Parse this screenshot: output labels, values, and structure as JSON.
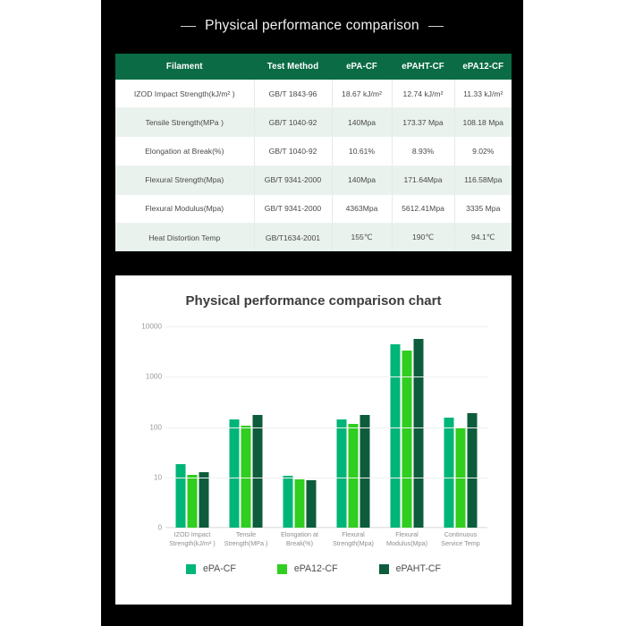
{
  "page": {
    "title": "Physical performance comparison",
    "background_color": "#000000",
    "margin_color": "#ffffff"
  },
  "table": {
    "header_color": "#0a6b45",
    "alt_row_color": "#e9f2ec",
    "columns": [
      "Filament",
      "Test Method",
      "ePA-CF",
      "ePAHT-CF",
      "ePA12-CF"
    ],
    "rows": [
      {
        "filament": "IZOD Impact Strength(kJ/m² )",
        "method": "GB/T 1843-96",
        "epa": "18.67 kJ/m²",
        "epaht": "12.74 kJ/m²",
        "epa12": "11.33 kJ/m²"
      },
      {
        "filament": "Tensile Strength(MPa )",
        "method": "GB/T 1040-92",
        "epa": "140Mpa",
        "epaht": "173.37 Mpa",
        "epa12": "108.18 Mpa"
      },
      {
        "filament": "Elongation at Break(%)",
        "method": "GB/T 1040-92",
        "epa": "10.61%",
        "epaht": "8.93%",
        "epa12": "9.02%"
      },
      {
        "filament": "Flexural Strength(Mpa)",
        "method": "GB/T 9341-2000",
        "epa": "140Mpa",
        "epaht": "171.64Mpa",
        "epa12": "116.58Mpa"
      },
      {
        "filament": "Flexural Modulus(Mpa)",
        "method": "GB/T 9341-2000",
        "epa": "4363Mpa",
        "epaht": "5612.41Mpa",
        "epa12": "3335 Mpa"
      },
      {
        "filament": "Heat Distortion Temp",
        "method": "GB/T1634-2001",
        "epa": "155℃",
        "epaht": "190℃",
        "epa12": "94.1℃"
      }
    ]
  },
  "chart_data": {
    "type": "bar",
    "title": "Physical performance comparison chart",
    "xlabel": "",
    "ylabel": "",
    "scale": "log-like",
    "yticks": [
      0,
      10,
      100,
      1000,
      10000
    ],
    "ytick_labels": [
      "0",
      "10",
      "100",
      "1000",
      "10000"
    ],
    "grid": true,
    "legend_position": "bottom",
    "categories": [
      "IZOD Impact Strength(kJ/m² )",
      "Tensile Strength(MPa )",
      "Elongation at Break(%)",
      "Flexural Strength(Mpa)",
      "Flexural Modulus(Mpa)",
      "Continuous Service Temp"
    ],
    "category_lines": [
      [
        "IZOD Impact",
        "Strength(kJ/m² )"
      ],
      [
        "Tensile",
        "Strength(MPa )"
      ],
      [
        "Elongation at",
        "Break(%)"
      ],
      [
        "Flexural",
        "Strength(Mpa)"
      ],
      [
        "Flexural",
        "Modulus(Mpa)"
      ],
      [
        "Continuous",
        "Service Temp"
      ]
    ],
    "series": [
      {
        "name": "ePA-CF",
        "color": "#00b578",
        "values": [
          18.67,
          140,
          10.61,
          140,
          4363,
          155
        ]
      },
      {
        "name": "ePA12-CF",
        "color": "#2fce1f",
        "values": [
          11.33,
          108.18,
          9.02,
          116.58,
          3335,
          94.1
        ]
      },
      {
        "name": "ePAHT-CF",
        "color": "#0d5c3c",
        "values": [
          12.74,
          173.37,
          8.93,
          171.64,
          5612.41,
          190
        ]
      }
    ]
  }
}
